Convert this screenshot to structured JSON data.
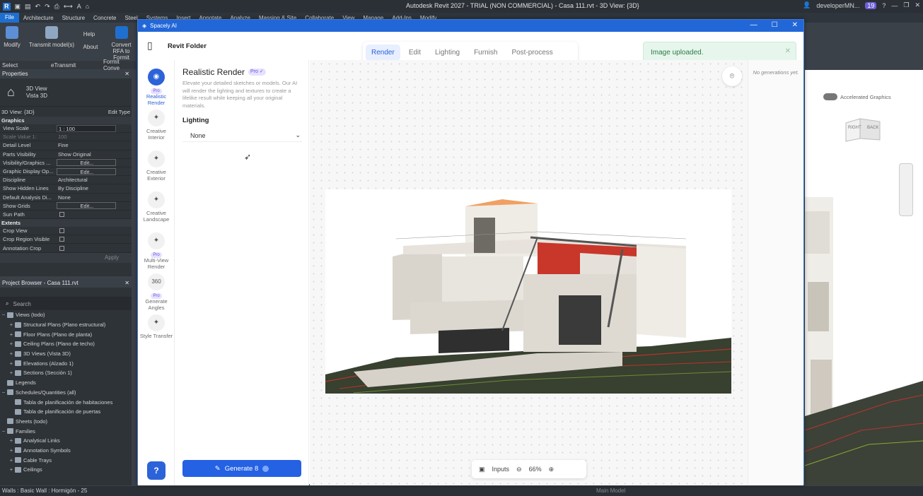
{
  "revit": {
    "title": "Autodesk Revit 2027 - TRIAL (NON COMMERCIAL) - Casa 111.rvt - 3D View: {3D}",
    "user": "developerMN...",
    "badge": "19",
    "tabs": [
      "File",
      "Architecture",
      "Structure",
      "Concrete",
      "Steel",
      "Systems",
      "Insert",
      "Annotate",
      "Analyze",
      "Massing & Site",
      "Collaborate",
      "View",
      "Manage",
      "Add-Ins",
      "Modify"
    ],
    "ribbon": {
      "modify": "Modify",
      "transmit": "Transmit model(s)",
      "help": "Help",
      "about": "About",
      "convert": "Convert RFA to Formit",
      "select": "Select",
      "etransmit": "eTransmit",
      "formit": "Formit Conve"
    },
    "properties": {
      "title": "Properties",
      "type_name": "3D View",
      "type_sub": "Vista 3D",
      "view_selector": "3D View: {3D}",
      "edit_type": "Edit Type",
      "section_graphics": "Graphics",
      "rows": [
        {
          "k": "View Scale",
          "v": "1 : 100",
          "kind": "box"
        },
        {
          "k": "Scale Value    1:",
          "v": "100",
          "kind": "dim"
        },
        {
          "k": "Detail Level",
          "v": "Fine",
          "kind": "text"
        },
        {
          "k": "Parts Visibility",
          "v": "Show Original",
          "kind": "text"
        },
        {
          "k": "Visibility/Graphics ...",
          "v": "Edit...",
          "kind": "btn"
        },
        {
          "k": "Graphic Display Op...",
          "v": "Edit...",
          "kind": "btn"
        },
        {
          "k": "Discipline",
          "v": "Architectural",
          "kind": "text"
        },
        {
          "k": "Show Hidden Lines",
          "v": "By Discipline",
          "kind": "text"
        },
        {
          "k": "Default Analysis Di...",
          "v": "None",
          "kind": "text"
        },
        {
          "k": "Show Grids",
          "v": "Edit...",
          "kind": "btn"
        },
        {
          "k": "Sun Path",
          "v": "",
          "kind": "chk"
        }
      ],
      "section_extents": "Extents",
      "extent_rows": [
        "Crop View",
        "Crop Region Visible",
        "Annotation Crop"
      ],
      "apply": "Apply"
    },
    "browser": {
      "title": "Project Browser - Casa 111.rvt",
      "search": "Search",
      "items": [
        {
          "t": "Views (todo)",
          "lvl": 0,
          "pl": "−"
        },
        {
          "t": "Structural Plans (Plano estructural)",
          "lvl": 1,
          "pl": "+"
        },
        {
          "t": "Floor Plans (Plano de planta)",
          "lvl": 1,
          "pl": "+"
        },
        {
          "t": "Ceiling Plans (Plano de techo)",
          "lvl": 1,
          "pl": "+"
        },
        {
          "t": "3D Views (Vista 3D)",
          "lvl": 1,
          "pl": "+"
        },
        {
          "t": "Elevations (Alzado 1)",
          "lvl": 1,
          "pl": "+"
        },
        {
          "t": "Sections (Sección 1)",
          "lvl": 1,
          "pl": "+"
        },
        {
          "t": "Legends",
          "lvl": 0,
          "pl": ""
        },
        {
          "t": "Schedules/Quantities (all)",
          "lvl": 0,
          "pl": "−"
        },
        {
          "t": "Tabla de planificación de habitaciones",
          "lvl": 1,
          "pl": ""
        },
        {
          "t": "Tabla de planificación de puertas",
          "lvl": 1,
          "pl": ""
        },
        {
          "t": "Sheets (todo)",
          "lvl": 0,
          "pl": ""
        },
        {
          "t": "Families",
          "lvl": 0,
          "pl": "−"
        },
        {
          "t": "Analytical Links",
          "lvl": 1,
          "pl": "+"
        },
        {
          "t": "Annotation Symbols",
          "lvl": 1,
          "pl": "+"
        },
        {
          "t": "Cable Trays",
          "lvl": 1,
          "pl": "+"
        },
        {
          "t": "Ceilings",
          "lvl": 1,
          "pl": "+"
        }
      ]
    },
    "status": "Walls : Basic Wall : Hormigón - 25",
    "status_model": "Main Model",
    "accel": "Accelerated Graphics",
    "viewcube": {
      "right": "RIGHT",
      "back": "BACK"
    }
  },
  "spacely": {
    "window_title": "Spacely AI",
    "folder": "Revit Folder",
    "tabs": [
      "Render",
      "Edit",
      "Lighting",
      "Furnish",
      "Post-process"
    ],
    "active_tab": "Render",
    "toast": "Image uploaded.",
    "tools": [
      {
        "label": "Realistic Render",
        "pro": "Pro",
        "active": true,
        "icon": "render-icon"
      },
      {
        "label": "Creative Interior",
        "pro": "",
        "active": false,
        "icon": "interior-icon"
      },
      {
        "label": "Creative Exterior",
        "pro": "",
        "active": false,
        "icon": "exterior-icon"
      },
      {
        "label": "Creative Landscape",
        "pro": "",
        "active": false,
        "icon": "landscape-icon"
      },
      {
        "label": "Multi-View Render",
        "pro": "Pro",
        "active": false,
        "icon": "multiview-icon"
      },
      {
        "label": "Generate Angles",
        "pro": "Pro",
        "active": false,
        "icon": "angles-icon",
        "glyph": "360"
      },
      {
        "label": "Style Transfer",
        "pro": "",
        "active": false,
        "icon": "style-icon"
      }
    ],
    "panel": {
      "title": "Realistic Render",
      "pro": "Pro ✓",
      "description": "Elevate your detailed sketches or models. Our AI will render the lighting and textures to create a lifelike result while keeping all your original materials.",
      "lighting_label": "Lighting",
      "lighting_value": "None",
      "generate": "Generate 8"
    },
    "no_generations": "No generations yet.",
    "bottom": {
      "inputs": "Inputs",
      "zoom": "66%"
    },
    "help": "?"
  },
  "colors": {
    "accent": "#2461e3",
    "revit_blue": "#2267d8",
    "toast_bg": "#e6f6ec"
  }
}
